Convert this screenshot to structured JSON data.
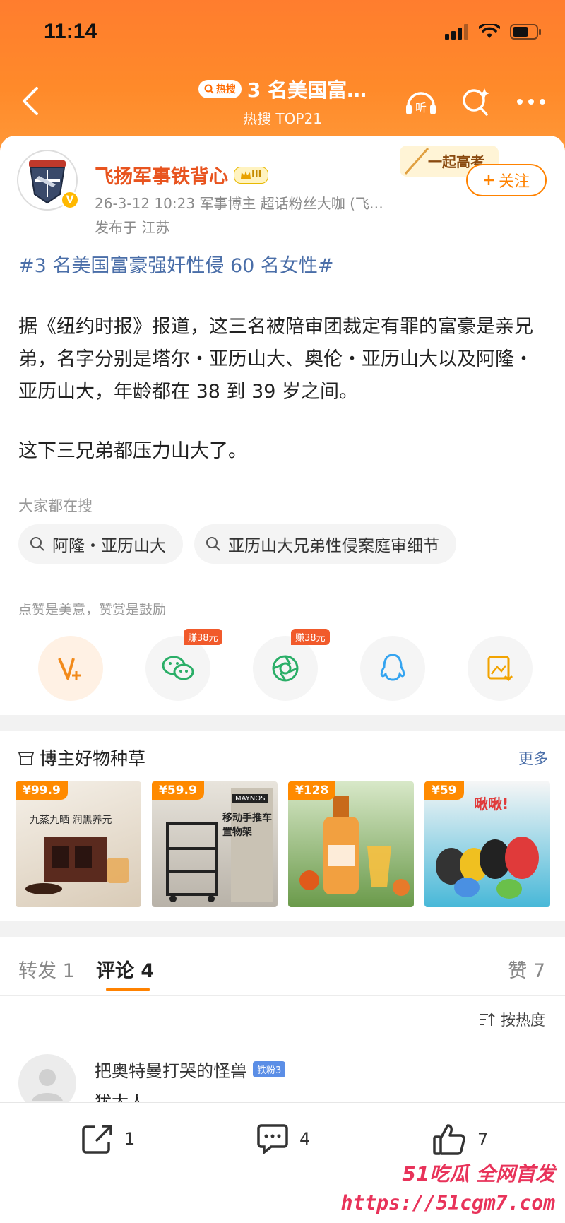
{
  "status_bar": {
    "time": "11:14"
  },
  "navbar": {
    "hot_badge": "热搜",
    "title": "3 名美国富…",
    "subtitle": "热搜 TOP21",
    "listen_label": "听"
  },
  "post": {
    "author": "飞扬军事铁背心",
    "level": "III",
    "meta": "26-3-12 10:23  军事博主 超话粉丝大咖 (飞…",
    "location": "发布于 江苏",
    "promo_text": "一起高考",
    "follow_label": "关注",
    "topic": "#3 名美国富豪强奸性侵 60 名女性#",
    "paragraph1": "据《纽约时报》报道，这三名被陪审团裁定有罪的富豪是亲兄弟，名字分别是塔尔・亚历山大、奥伦・亚历山大以及阿隆・亚历山大，年龄都在 38 到 39 岁之间。",
    "paragraph2": "这下三兄弟都压力山大了。",
    "search_label": "大家都在搜",
    "search_chips": [
      "阿隆・亚历山大",
      "亚历山大兄弟性侵案庭审细节"
    ],
    "like_hint": "点赞是美意，赞赏是鼓励",
    "earn_badges": [
      "赚38元",
      "赚38元"
    ]
  },
  "goods": {
    "title": "博主好物种草",
    "more": "更多",
    "items": [
      {
        "price": "¥99.9",
        "text": "九蒸九晒 润黑养元"
      },
      {
        "price": "¥59.9",
        "text": "移动手推车 置物架",
        "brand": "MAYNOS"
      },
      {
        "price": "¥128",
        "text": ""
      },
      {
        "price": "¥59",
        "text": "啾啾!"
      }
    ]
  },
  "tabs": {
    "repost": "转发 1",
    "comments": "评论 4",
    "likes": "赞 7"
  },
  "sort_label": "按热度",
  "comment": {
    "name": "把奥特曼打哭的怪兽",
    "badge": "铁粉3",
    "text": "犹太人"
  },
  "bottom_bar": {
    "repost_count": "1",
    "comment_count": "4",
    "like_count": "7"
  },
  "watermark": {
    "line1": "51吃瓜 全网首发",
    "line2": "https://51cgm7.com"
  },
  "colors": {
    "accent": "#ff8200",
    "header": "#ff7d2e",
    "author_name": "#e8541f",
    "topic_link": "#4a6ea8"
  }
}
